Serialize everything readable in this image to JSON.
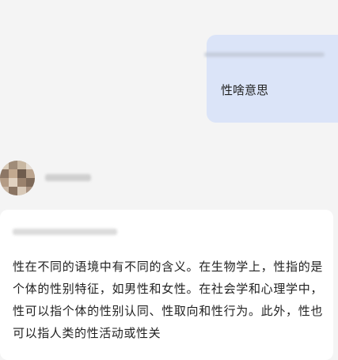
{
  "conversation": {
    "user_message": {
      "text": "性啥意思"
    },
    "assistant_message": {
      "text": "性在不同的语境中有不同的含义。在生物学上，性指的是个体的性别特征，如男性和女性。在社会学和心理学中，性可以指个体的性别认同、性取向和性行为。此外，性也可以指人类的性活动或性关"
    }
  },
  "colors": {
    "background": "#f4f4f4",
    "user_bubble": "#dbe4f8",
    "assistant_card": "#ffffff",
    "text": "#222222"
  }
}
